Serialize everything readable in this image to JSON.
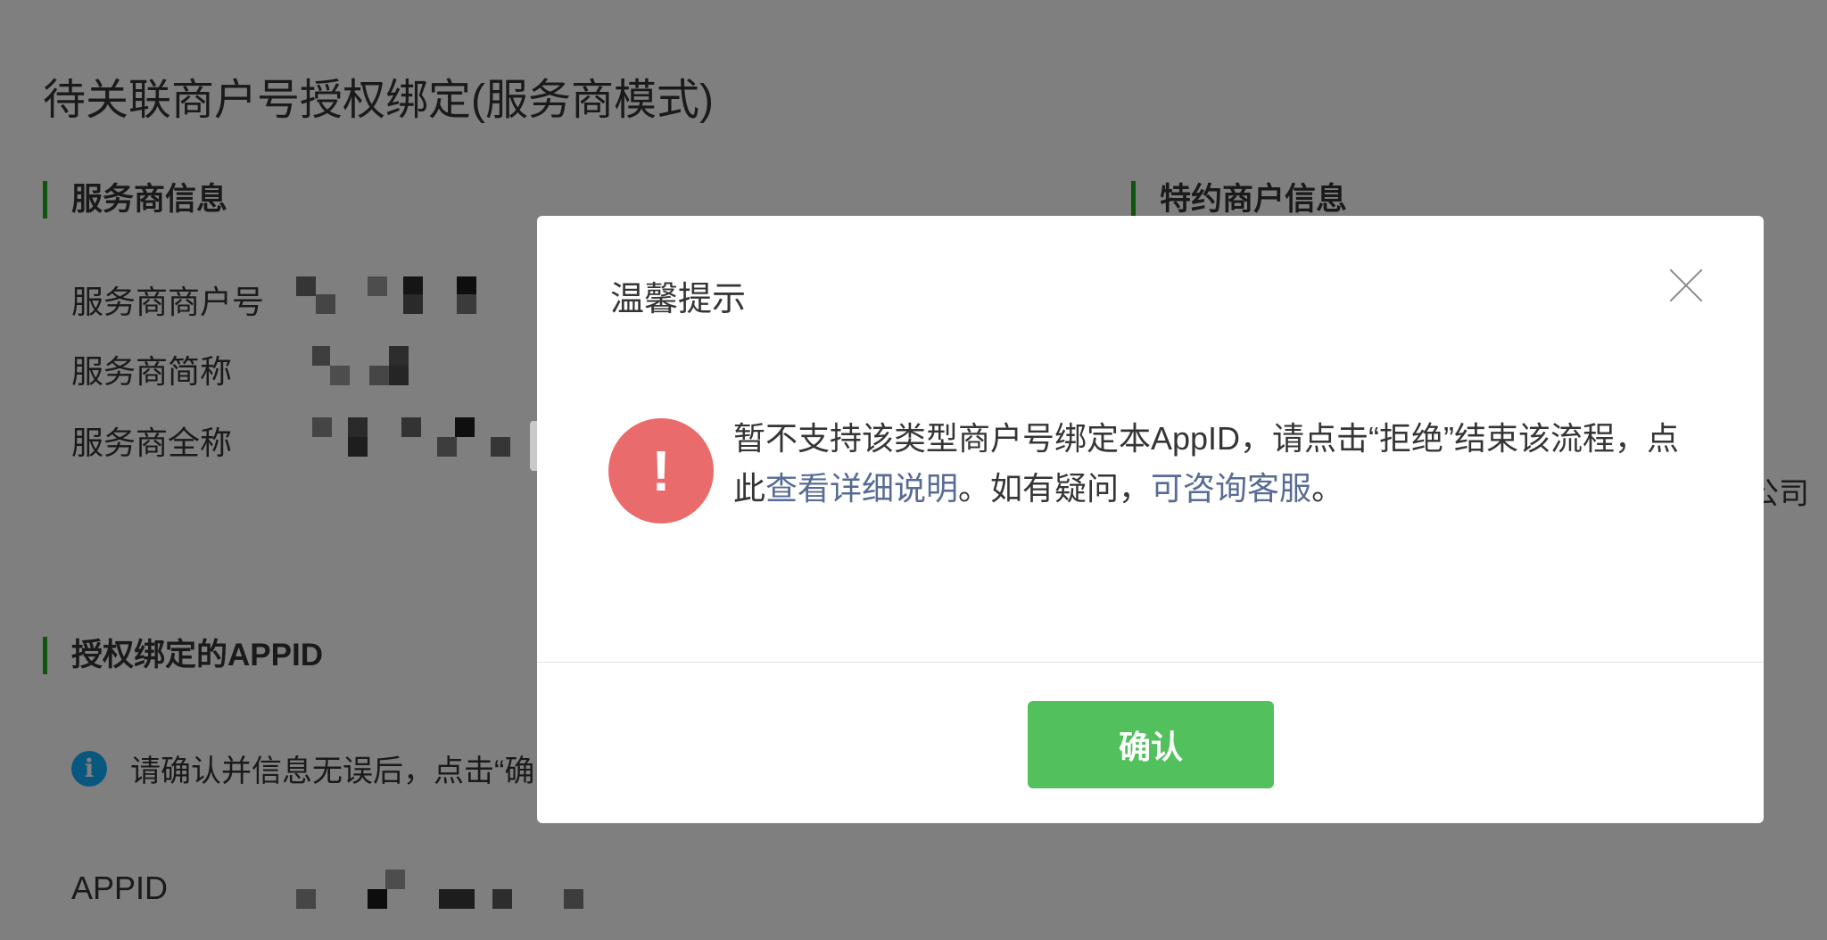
{
  "page": {
    "title": "待关联商户号授权绑定(服务商模式)",
    "sections": {
      "provider_info": "服务商信息",
      "merchant_info": "特约商户信息",
      "bound_appid": "授权绑定的APPID"
    },
    "provider_fields": [
      {
        "label": "服务商商户号"
      },
      {
        "label": "服务商简称"
      },
      {
        "label": "服务商全称"
      }
    ],
    "merchant_fragment": "公司",
    "notice_text": "请确认并信息无误后，点击“确",
    "appid_label": "APPID"
  },
  "dialog": {
    "title": "温馨提示",
    "icon_glyph": "!",
    "message_before": "暂不支持该类型商户号绑定本AppID，请点击“拒绝”结束该流程，点此",
    "link_details": "查看详细说明",
    "message_middle": "。如有疑问，",
    "link_support": "可咨询客服",
    "message_after": "。",
    "confirm_label": "确认"
  },
  "colors": {
    "accent_green": "#1aad19",
    "confirm_button": "#53c05e",
    "warning_red": "#e96b6b",
    "link_blue": "#576b95",
    "info_blue": "#10aeff",
    "overlay": "rgba(0,0,0,0.5)"
  },
  "icons": {
    "close": "close-icon",
    "warning": "warning-exclamation-icon",
    "info": "info-icon"
  }
}
